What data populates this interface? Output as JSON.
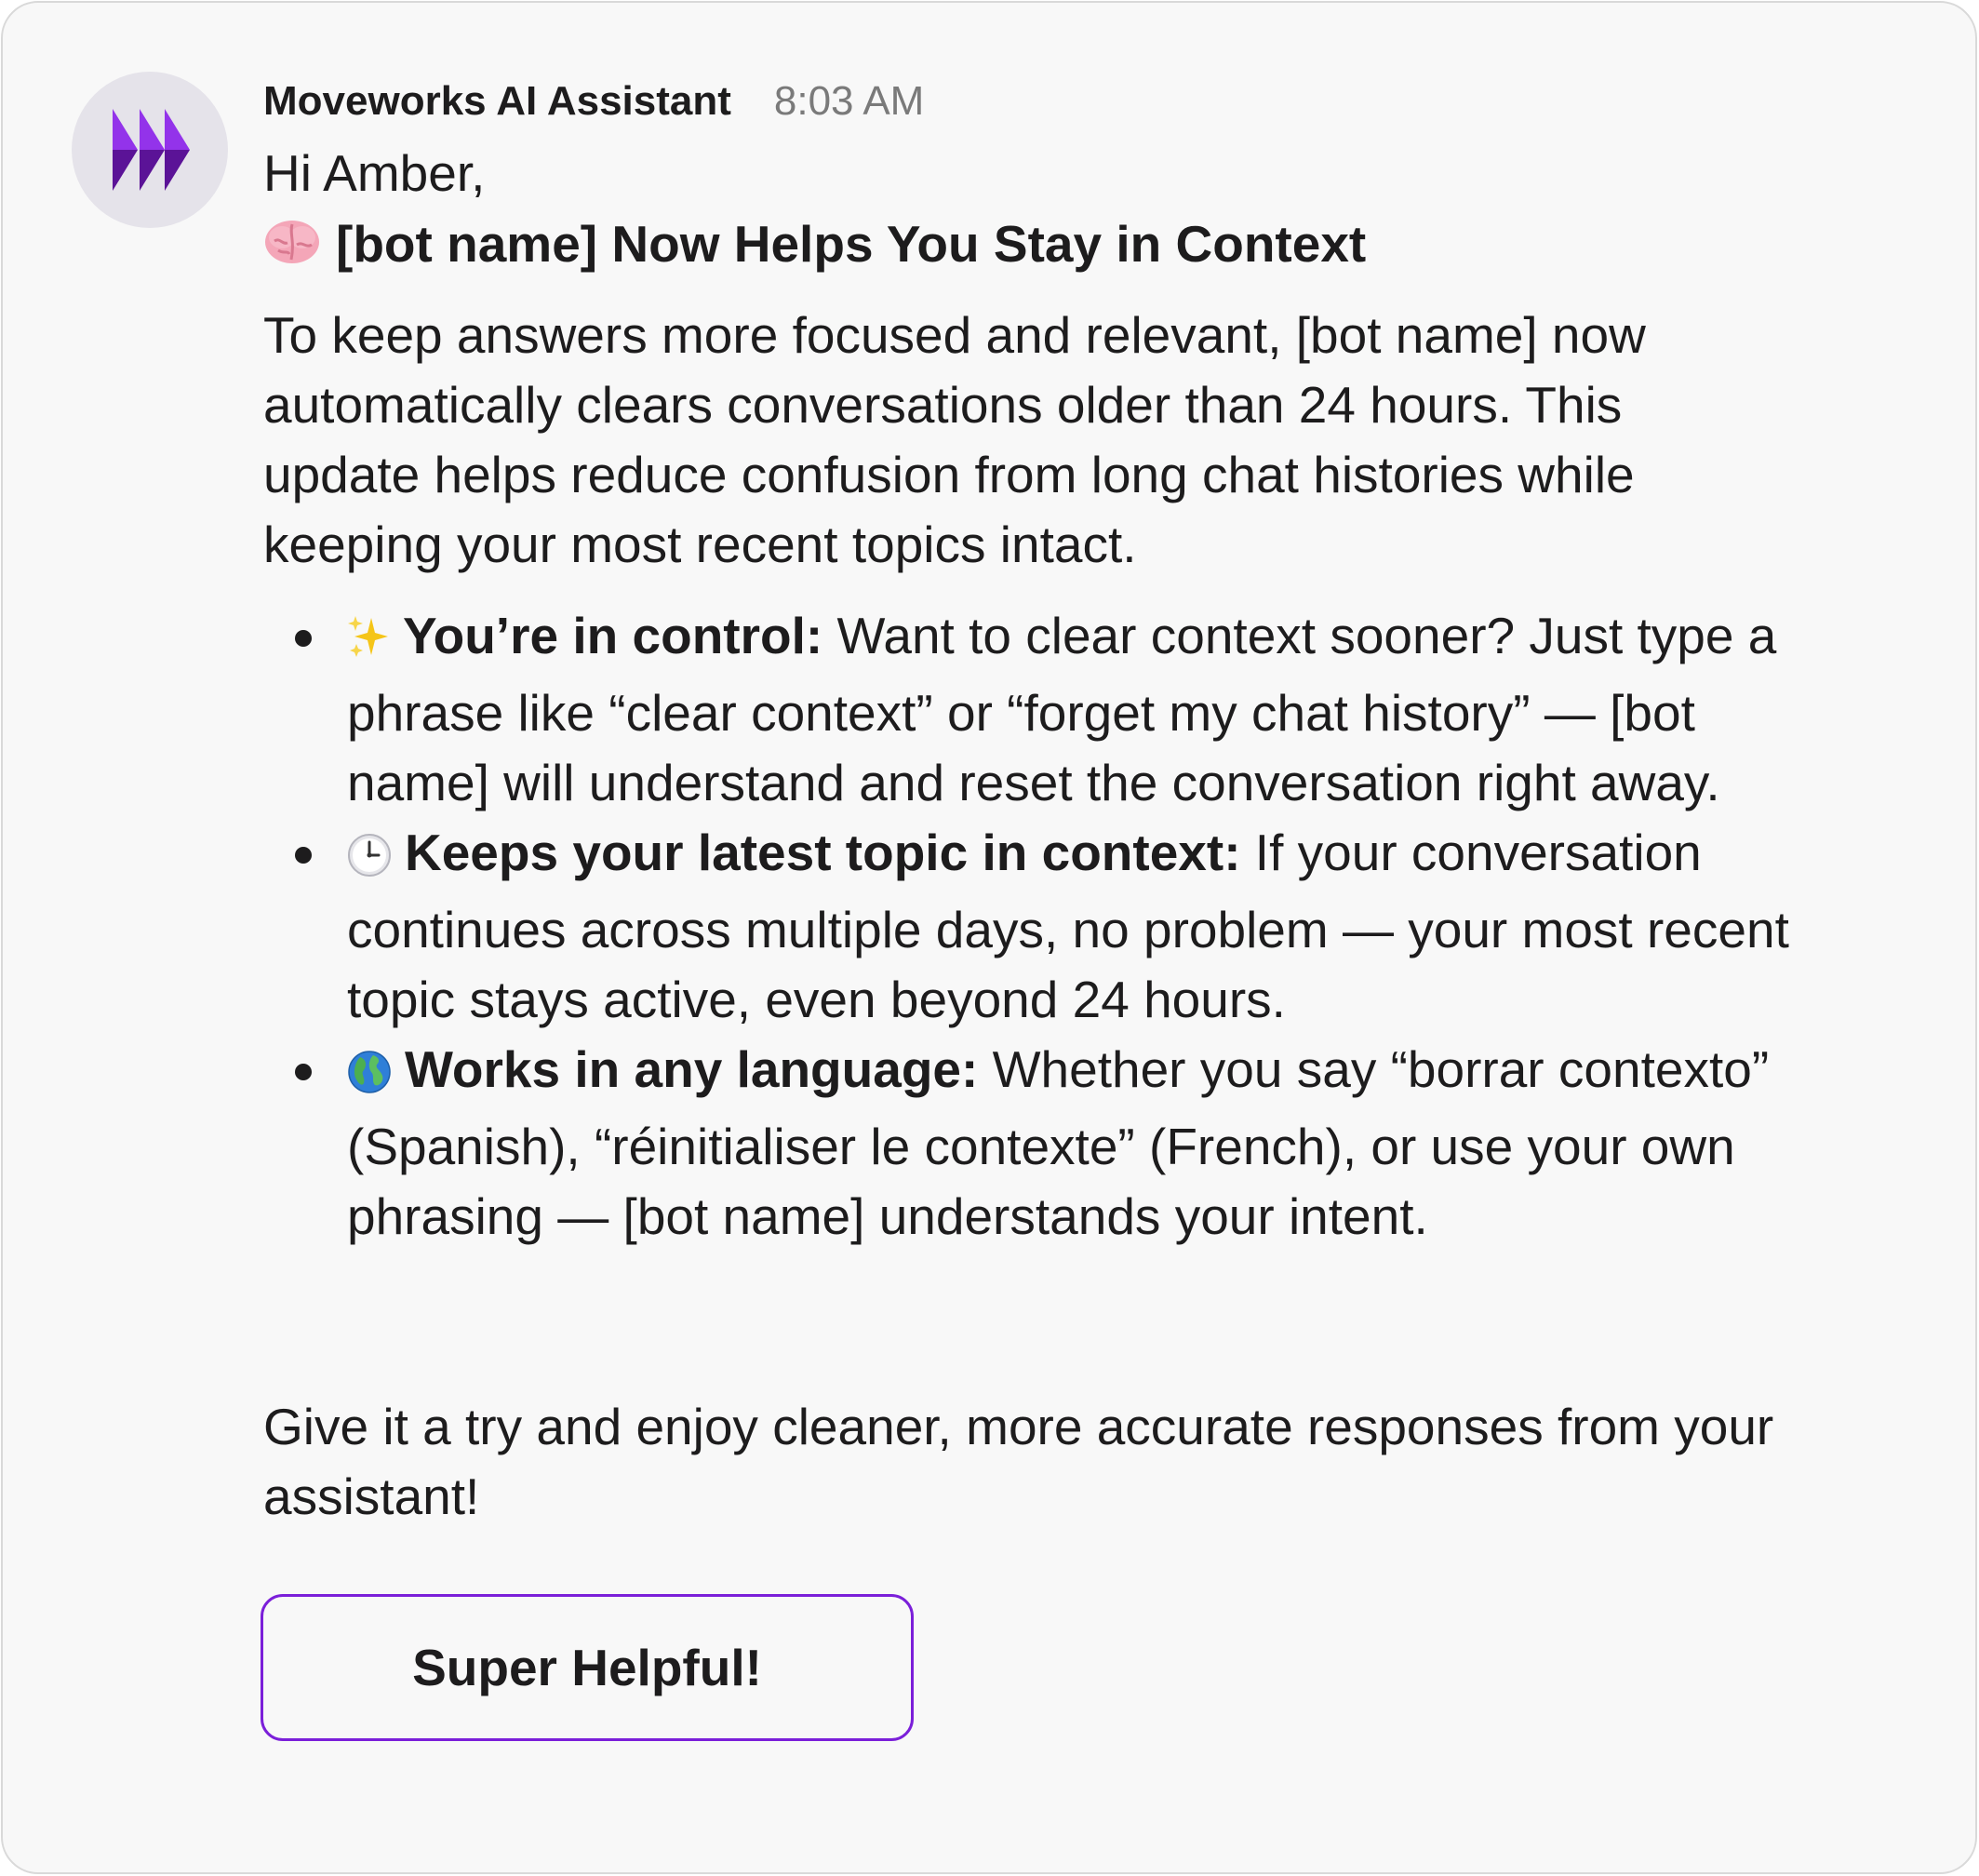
{
  "message": {
    "sender": "Moveworks AI Assistant",
    "time": "8:03 AM",
    "avatar_icon": "moveworks-logo-icon",
    "greeting": "Hi Amber,",
    "headline": {
      "emoji": "brain-icon",
      "text": "[bot name] Now Helps You Stay in Context"
    },
    "intro": "To keep answers more focused and relevant, [bot name] now automatically clears conversations older than 24 hours. This update helps reduce confusion from long chat histories while keeping your most recent topics intact.",
    "bullets": [
      {
        "emoji": "sparkles-icon",
        "title": "You’re in control:",
        "text": " Want to clear context sooner? Just type a phrase like “clear context” or “forget my chat history” — [bot name] will understand and reset the conversation right away."
      },
      {
        "emoji": "clock-icon",
        "title": "Keeps your latest topic in context:",
        "text": " If your conversation continues across multiple days, no problem — your most recent topic stays active, even beyond 24 hours."
      },
      {
        "emoji": "globe-icon",
        "title": "Works in any language:",
        "text": " Whether you say “borrar contexto” (Spanish), “réinitialiser le contexte” (French), or use your own phrasing — [bot name] understands your intent."
      }
    ],
    "outro": "Give it a try and enjoy cleaner, more accurate responses from your assistant!",
    "button_label": "Super Helpful!"
  },
  "colors": {
    "brand_purple": "#7b1fd9",
    "background": "#f8f8f8",
    "timestamp": "#7a7a7a"
  }
}
